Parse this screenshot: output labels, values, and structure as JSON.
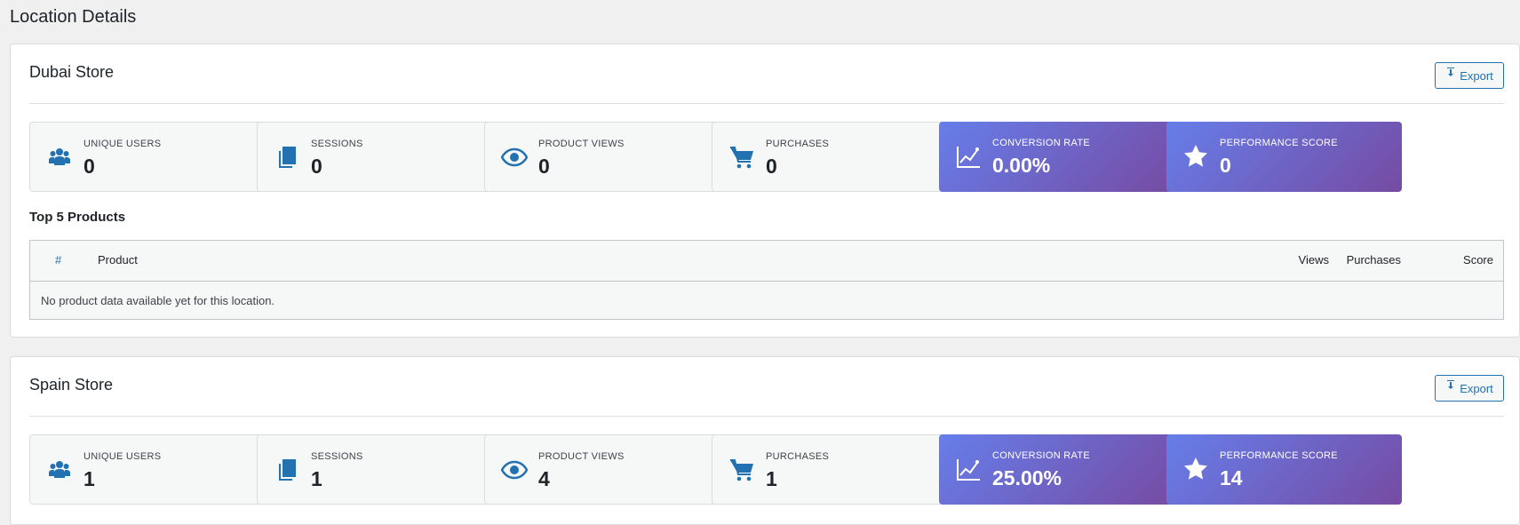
{
  "page": {
    "title": "Location Details"
  },
  "locations": [
    {
      "name": "Dubai Store",
      "export_label": "Export",
      "stats": [
        {
          "label": "UNIQUE USERS",
          "value": "0",
          "icon": "users-icon"
        },
        {
          "label": "SESSIONS",
          "value": "0",
          "icon": "copy-icon"
        },
        {
          "label": "PRODUCT VIEWS",
          "value": "0",
          "icon": "eye-icon"
        },
        {
          "label": "PURCHASES",
          "value": "0",
          "icon": "cart-icon"
        },
        {
          "label": "CONVERSION RATE",
          "value": "0.00%",
          "icon": "chart-line-icon"
        },
        {
          "label": "PERFORMANCE SCORE",
          "value": "0",
          "icon": "star-icon"
        }
      ],
      "top_products_title": "Top 5 Products",
      "table": {
        "columns": [
          "#",
          "Product",
          "Views",
          "Purchases",
          "Score"
        ],
        "empty_message": "No product data available yet for this location."
      }
    },
    {
      "name": "Spain Store",
      "export_label": "Export",
      "stats": [
        {
          "label": "UNIQUE USERS",
          "value": "1",
          "icon": "users-icon"
        },
        {
          "label": "SESSIONS",
          "value": "1",
          "icon": "copy-icon"
        },
        {
          "label": "PRODUCT VIEWS",
          "value": "4",
          "icon": "eye-icon"
        },
        {
          "label": "PURCHASES",
          "value": "1",
          "icon": "cart-icon"
        },
        {
          "label": "CONVERSION RATE",
          "value": "25.00%",
          "icon": "chart-line-icon"
        },
        {
          "label": "PERFORMANCE SCORE",
          "value": "14",
          "icon": "star-icon"
        }
      ]
    }
  ],
  "colors": {
    "accent": "#2271b1",
    "gradient_start": "#667eea",
    "gradient_end": "#764ba2",
    "background": "#f0f0f1"
  }
}
